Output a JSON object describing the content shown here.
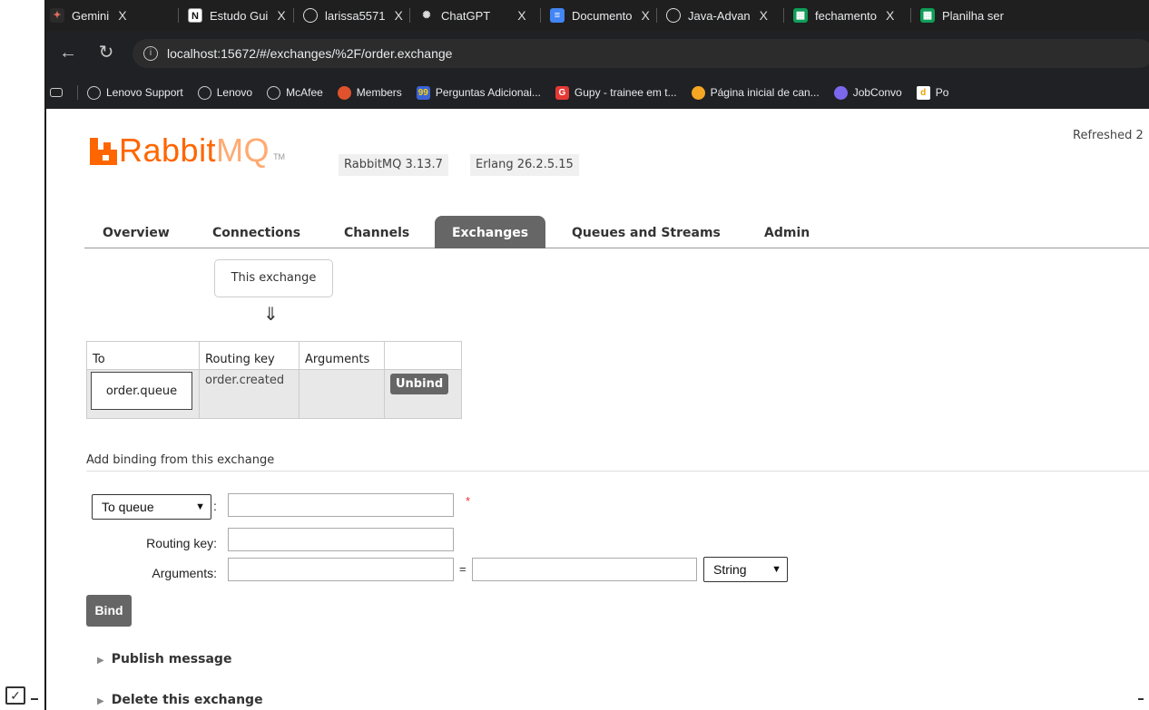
{
  "browser": {
    "tabs": [
      {
        "label": "Gemini",
        "icon": "gemini-icon"
      },
      {
        "label": "Estudo Gui",
        "icon": "notion-icon"
      },
      {
        "label": "larissa5571",
        "icon": "github-icon"
      },
      {
        "label": "ChatGPT",
        "icon": "chatgpt-icon"
      },
      {
        "label": "Documento",
        "icon": "docs-icon"
      },
      {
        "label": "Java-Advan",
        "icon": "github-icon"
      },
      {
        "label": "fechamento",
        "icon": "sheets-icon"
      },
      {
        "label": "Planilha ser",
        "icon": "sheets-icon"
      }
    ],
    "close_glyph": "X",
    "url": "localhost:15672/#/exchanges/%2F/order.exchange",
    "bookmarks": [
      {
        "label": "Lenovo Support",
        "icon": "globe-icon"
      },
      {
        "label": "Lenovo",
        "icon": "globe-icon"
      },
      {
        "label": "McAfee",
        "icon": "globe-icon"
      },
      {
        "label": "Members",
        "icon": "members-icon"
      },
      {
        "label": "Perguntas Adicionai...",
        "icon": "99-icon"
      },
      {
        "label": "Gupy - trainee em t...",
        "icon": "gupy-icon"
      },
      {
        "label": "Página inicial de can...",
        "icon": "canvas-icon"
      },
      {
        "label": "JobConvo",
        "icon": "jobconvo-icon"
      },
      {
        "label": "Po",
        "icon": "d-icon"
      }
    ]
  },
  "header": {
    "logo_rabbit": "Rabbit",
    "logo_mq": "MQ",
    "logo_tm": "TM",
    "version": "RabbitMQ 3.13.7",
    "erlang": "Erlang 26.2.5.15",
    "refreshed": "Refreshed 2"
  },
  "nav": {
    "tabs": [
      "Overview",
      "Connections",
      "Channels",
      "Exchanges",
      "Queues and Streams",
      "Admin"
    ],
    "active": "Exchanges"
  },
  "bindings": {
    "this_exchange": "This exchange",
    "arrow": "⇓",
    "headers": [
      "To",
      "Routing key",
      "Arguments",
      ""
    ],
    "rows": [
      {
        "to": "order.queue",
        "routing_key": "order.created",
        "arguments": "",
        "action": "Unbind"
      }
    ]
  },
  "add_binding": {
    "title": "Add binding from this exchange",
    "destination_type": "To queue",
    "colon": ":",
    "required_mark": "*",
    "routing_key_label": "Routing key:",
    "arguments_label": "Arguments:",
    "equals": "=",
    "arg_type": "String",
    "bind_label": "Bind"
  },
  "sections": {
    "publish": "Publish message",
    "delete": "Delete this exchange"
  }
}
